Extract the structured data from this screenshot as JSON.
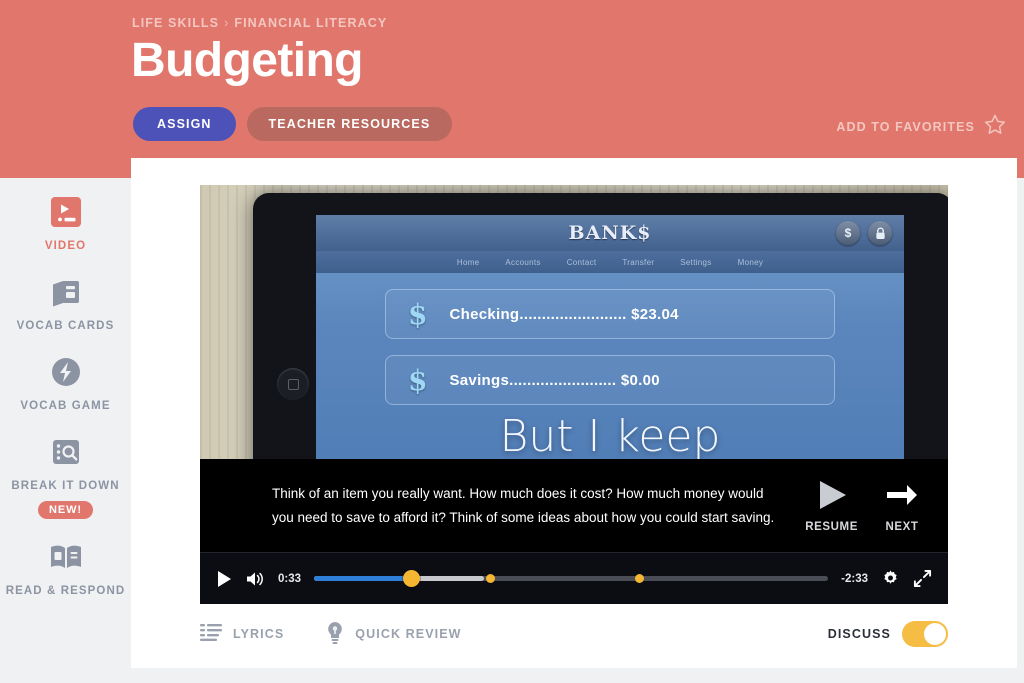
{
  "header": {
    "breadcrumb": {
      "parent": "LIFE SKILLS",
      "separator": "›",
      "current": "FINANCIAL LITERACY"
    },
    "title": "Budgeting",
    "assign_label": "ASSIGN",
    "resources_label": "TEACHER RESOURCES",
    "favorites_label": "ADD TO FAVORITES",
    "favorites_icon": "star-outline-icon",
    "bg_color": "#e1776c",
    "assign_color": "#4c52b8",
    "resources_color": "#b9695f"
  },
  "sidebar": {
    "items": [
      {
        "label": "VIDEO",
        "icon": "video-icon",
        "active": true
      },
      {
        "label": "VOCAB CARDS",
        "icon": "cards-icon",
        "active": false
      },
      {
        "label": "VOCAB GAME",
        "icon": "lightning-bolt-icon",
        "active": false
      },
      {
        "label": "BREAK IT DOWN",
        "icon": "magnifier-grid-icon",
        "active": false,
        "badge": "NEW!"
      },
      {
        "label": "READ & RESPOND",
        "icon": "open-book-icon",
        "active": false
      }
    ],
    "active_color": "#e1776c",
    "inactive_color": "#8c94a3",
    "badge_color": "#e1776c"
  },
  "video": {
    "scene": {
      "bank_logo": "BANK$",
      "nav": [
        "Home",
        "Accounts",
        "Contact",
        "Transfer",
        "Settings",
        "Money"
      ],
      "top_icons": [
        "dollar-icon",
        "lock-icon"
      ],
      "accounts": [
        {
          "icon": "dollar-sign-icon",
          "name": "Checking",
          "dots": "........................",
          "amount": "$23.04"
        },
        {
          "icon": "dollar-sign-icon",
          "name": "Savings",
          "dots": "........................",
          "amount": "$0.00"
        }
      ],
      "lyric_overlay": "But I keep"
    },
    "caption": "Think of an item you really want. How much does it cost? How much money would you need to save to afford it? Think of some ideas about how you could start saving.",
    "caption_actions": [
      {
        "label": "RESUME",
        "icon": "play-icon"
      },
      {
        "label": "NEXT",
        "icon": "arrow-right-icon"
      }
    ],
    "controls": {
      "play_icon": "play-icon",
      "volume_icon": "volume-on-icon",
      "elapsed": "0:33",
      "remaining": "-2:33",
      "settings_icon": "gear-icon",
      "fullscreen_icon": "expand-icon",
      "played_percent": 18.2,
      "buffered_percent": 33,
      "markers_percent": [
        33.5,
        62.5
      ],
      "scrubber_percent": 18.2,
      "played_color": "#2f7fd8",
      "marker_color": "#f5b731"
    }
  },
  "toolbar": {
    "lyrics_label": "LYRICS",
    "lyrics_icon": "list-lines-icon",
    "quick_review_label": "QUICK REVIEW",
    "quick_review_icon": "lightbulb-icon",
    "discuss_label": "DISCUSS",
    "discuss_on": true,
    "toggle_color": "#f5bd43"
  }
}
